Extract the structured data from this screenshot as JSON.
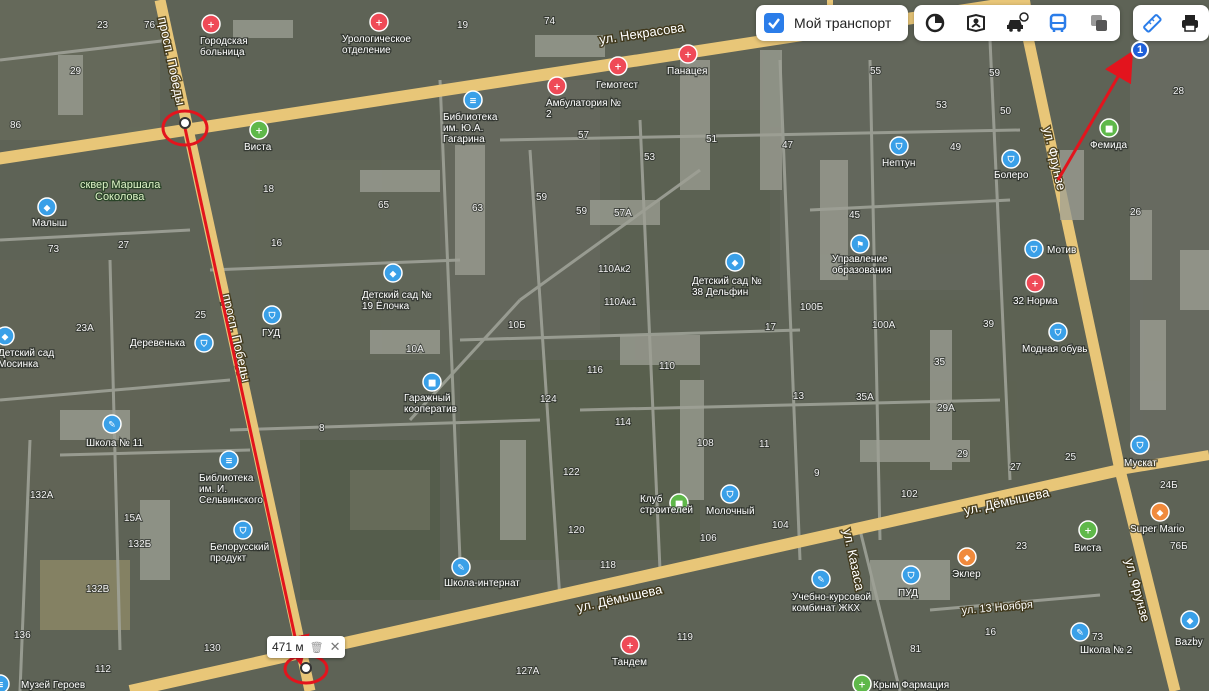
{
  "toolbar": {
    "my_transport_label": "Мой транспорт",
    "my_transport_checked": true,
    "modes": [
      "layers-circle-icon",
      "panorama-icon",
      "traffic-car-icon",
      "transit-bus-icon",
      "overlay-icon"
    ],
    "tools": [
      "ruler-icon",
      "print-icon"
    ]
  },
  "measure": {
    "distance_label": "471 м",
    "route_badge": "1"
  },
  "streets": {
    "prosp_pobedy": "просп. Победы",
    "prosp_pobedy_2": "просп. Победы",
    "nekrasova": "ул. Некрасова",
    "demysheva_1": "ул. Дёмышева",
    "demysheva_2": "ул. Дёмышева",
    "frunze_1": "ул. Фрунзе",
    "frunze_2": "ул. Фрунзе",
    "kazasa": "ул. Казаса",
    "noyabrya": "ул. 13 Ноября"
  },
  "park": "сквер Маршала Соколова",
  "pois": {
    "gor_bolnica": "Городская больница",
    "urolog": "Урологическое отделение",
    "panaceya": "Панацея",
    "gemotest": "Гемотест",
    "ambulatoria": "Амбулатория № 2",
    "biblioteka_gagarina": "Библиотека им. Ю.А. Гагарина",
    "vista_1": "Виста",
    "malysh": "Малыш",
    "neptun": "Нептун",
    "bolero": "Болеро",
    "femida": "Фемида",
    "upravlenie": "Управление образования",
    "motiv": "Мотив",
    "32norma": "32 Норма",
    "modnaya": "Модная обувь",
    "detsad_elochka": "Детский сад № 19 Ёлочка",
    "detsad_delfin": "Детский сад № 38 Дельфин",
    "gud": "ГУД",
    "derevenka": "Деревенька",
    "detsad_left": "Детский сад Мосинка",
    "garazh": "Гаражный кооператив",
    "shkola11": "Школа № 11",
    "biblioteka_selvin": "Библиотека им. И. Сельвинского",
    "belorus": "Белорусский продукт",
    "klub": "Клуб строителей",
    "molochny": "Молочный",
    "shkola_internat": "Школа-интернат",
    "uchebno": "Учебно-курсовой комбинат ЖКХ",
    "ekler": "Эклер",
    "pud": "ПУД",
    "vista_2": "Виста",
    "muskat": "Мускат",
    "super_mario": "Super Mario",
    "bazby": "Bazby",
    "shkola2": "Школа № 2",
    "tandem": "Тандем",
    "krym_farm": "Крым Фармация",
    "muzey": "Музей Героев"
  },
  "house_numbers": [
    "23",
    "76",
    "19",
    "74",
    "29",
    "86",
    "57",
    "59",
    "55",
    "59",
    "53",
    "51",
    "49",
    "28",
    "50",
    "53",
    "47",
    "26",
    "65",
    "18",
    "63",
    "59",
    "57A",
    "45",
    "16",
    "27",
    "73",
    "25",
    "110Ак2",
    "110Ак1",
    "100Б",
    "17",
    "100А",
    "39",
    "23А",
    "10Б",
    "10А",
    "116",
    "110",
    "35",
    "13",
    "35А",
    "29А",
    "8",
    "124",
    "114",
    "108",
    "11",
    "29",
    "27",
    "25",
    "132А",
    "122",
    "9",
    "102",
    "24Б",
    "15А",
    "132Б",
    "120",
    "106",
    "104",
    "23",
    "76Б",
    "132В",
    "118",
    "136",
    "130",
    "127А",
    "112",
    "119",
    "81",
    "16",
    "73"
  ],
  "colors": {
    "road": "#e8c678",
    "measure": "#e3141d",
    "poi_health": "#ef4a57",
    "poi_shop": "#3aa0e8",
    "poi_green": "#5fb84a",
    "accent": "#2b7de9"
  }
}
